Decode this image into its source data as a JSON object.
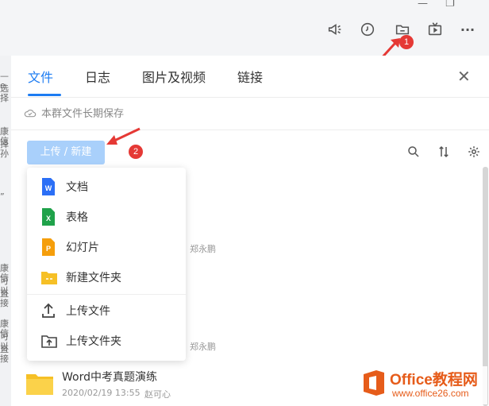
{
  "window": {
    "minimize": "—",
    "maximize": "❐",
    "close": "✕"
  },
  "toolbar": {
    "icons": [
      "megaphone-icon",
      "clock-icon",
      "folder-icon",
      "tv-icon",
      "more-icon"
    ],
    "more_label": "···",
    "badge_1": "1"
  },
  "left_fragments": [
    "— e",
    "选择",
    "康信",
    "择孙",
    "”",
    "康信",
    "可以",
    "直接",
    "康信",
    "可以",
    "直接"
  ],
  "tabs": [
    {
      "label": "文件",
      "active": true
    },
    {
      "label": "日志",
      "active": false
    },
    {
      "label": "图片及视频",
      "active": false
    },
    {
      "label": "链接",
      "active": false
    }
  ],
  "close_label": "✕",
  "notice": "本群文件长期保存",
  "upload_button": "上传 / 新建",
  "badge_2": "2",
  "dropdown": {
    "items": [
      {
        "label": "文档",
        "icon": "word-doc-icon",
        "color": "#2b6ff6",
        "letter": "W"
      },
      {
        "label": "表格",
        "icon": "sheet-icon",
        "color": "#1fa24a",
        "letter": "X"
      },
      {
        "label": "幻灯片",
        "icon": "slides-icon",
        "color": "#f59e0b",
        "letter": "P"
      },
      {
        "label": "新建文件夹",
        "icon": "new-folder-icon",
        "color": "#f6c026",
        "letter": ""
      },
      {
        "label": "上传文件",
        "icon": "upload-file-icon",
        "color": "#444444",
        "letter": ""
      },
      {
        "label": "上传文件夹",
        "icon": "upload-folder-icon",
        "color": "#444444",
        "letter": ""
      }
    ]
  },
  "background_uploaders": [
    "郑永鹏",
    "郑永鹏"
  ],
  "file": {
    "name": "Word中考真题演练",
    "date": "2020/02/19 13:55",
    "uploader": "赵可心"
  },
  "watermark": {
    "title": "Office教程网",
    "url": "www.office26.com"
  },
  "colors": {
    "accent": "#1d7cf2",
    "badge": "#e53935",
    "watermark": "#e65c1a"
  }
}
